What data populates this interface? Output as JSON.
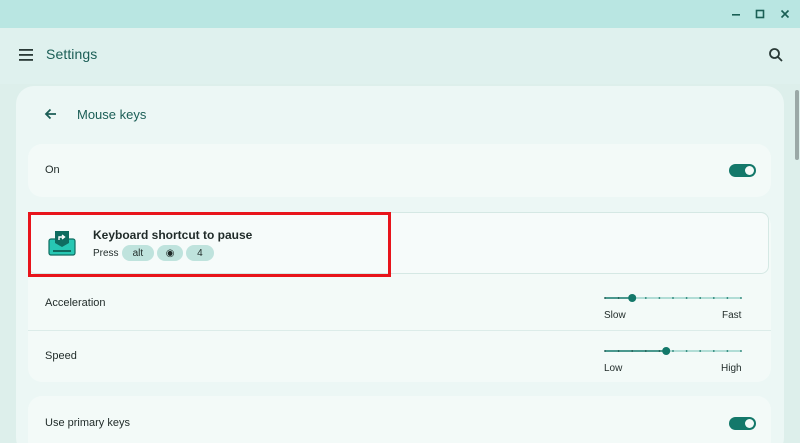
{
  "window": {
    "minimize_icon": "minimize-icon",
    "maximize_icon": "maximize-icon",
    "close_icon": "close-icon"
  },
  "header": {
    "title": "Settings",
    "menu_icon": "hamburger-menu-icon",
    "search_icon": "search-icon"
  },
  "page": {
    "title": "Mouse keys",
    "back_icon": "arrow-left-icon"
  },
  "on_row": {
    "label": "On",
    "toggle_on": true
  },
  "shortcut": {
    "title": "Keyboard shortcut to pause",
    "press_label": "Press",
    "keys": [
      "alt",
      "◉",
      "4"
    ]
  },
  "acceleration": {
    "label": "Acceleration",
    "min_label": "Slow",
    "max_label": "Fast",
    "value": 0.2
  },
  "speed": {
    "label": "Speed",
    "min_label": "Low",
    "max_label": "High",
    "value": 0.45
  },
  "primary_keys": {
    "label": "Use primary keys",
    "toggle_on": true
  },
  "colors": {
    "accent": "#13786a",
    "highlight": "#e8141b"
  }
}
